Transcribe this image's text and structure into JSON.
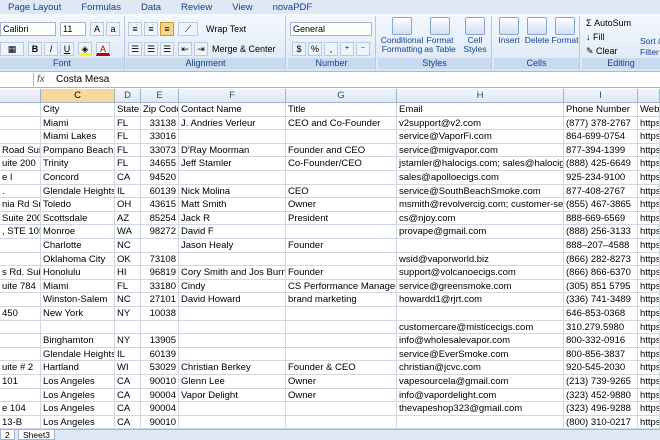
{
  "ribbon_tabs": [
    "Page Layout",
    "Formulas",
    "Data",
    "Review",
    "View",
    "novaPDF"
  ],
  "font": {
    "name": "Calibri",
    "size": "11",
    "group_label": "Font",
    "bold": "B",
    "italic": "I",
    "underline": "U",
    "color_a": "A"
  },
  "alignment": {
    "group_label": "Alignment",
    "wrap_text": "Wrap Text",
    "merge_center": "Merge & Center"
  },
  "number": {
    "group_label": "Number",
    "format": "General",
    "currency": "$",
    "percent": "%",
    "comma": ","
  },
  "styles": {
    "group_label": "Styles",
    "conditional": "Conditional Formatting",
    "format_table": "Format as Table",
    "cell_styles": "Cell Styles"
  },
  "cells": {
    "group_label": "Cells",
    "insert": "Insert",
    "delete": "Delete",
    "format": "Format"
  },
  "editing": {
    "group_label": "Editing",
    "autosum": "AutoSum",
    "fill": "Fill",
    "clear": "Clear",
    "sort": "Sort & Filter"
  },
  "formula_bar": {
    "fx": "fx",
    "value": "Costa Mesa"
  },
  "columns": [
    "C",
    "D",
    "E",
    "F",
    "G",
    "H",
    "I"
  ],
  "header_row": [
    "City",
    "State",
    "Zip Code",
    "Contact Name",
    "Title",
    "Email",
    "Phone Number",
    "Web"
  ],
  "rows": [
    {
      "a": "",
      "c": "Miami",
      "d": "FL",
      "e": "33138",
      "f": "J. Andries Verleur",
      "g": "CEO and Co-Founder",
      "h": "v2support@v2.com",
      "i": "(877) 378-2767",
      "j": "https"
    },
    {
      "a": "",
      "c": "Miami Lakes",
      "d": "FL",
      "e": "33016",
      "f": "",
      "g": "",
      "h": "service@VaporFi.com",
      "i": "864-699-0754",
      "j": "https"
    },
    {
      "a": "Road Suite",
      "c": "Pompano Beach",
      "d": "FL",
      "e": "33073",
      "f": "D'Ray Moorman",
      "g": "Founder and CEO",
      "h": "service@migvapor.com",
      "i": "877-394-1399",
      "j": "https"
    },
    {
      "a": "uite 200",
      "c": "Trinity",
      "d": "FL",
      "e": "34655",
      "f": "Jeff Stamler",
      "g": "Co-Founder/CEO",
      "h": "jstamler@halocigs.com; sales@halocigs.c",
      "i": "(888) 425-6649",
      "j": "https"
    },
    {
      "a": "e I",
      "c": "Concord",
      "d": "CA",
      "e": "94520",
      "f": "",
      "g": "",
      "h": "sales@apolloecigs.com",
      "i": "925-234-9100",
      "j": "https"
    },
    {
      "a": ".",
      "c": "Glendale Heights",
      "d": "IL",
      "e": "60139",
      "f": "Nick Molina",
      "g": "CEO",
      "h": "service@SouthBeachSmoke.com",
      "i": "877-408-2767",
      "j": "https"
    },
    {
      "a": "nia Rd Suit",
      "c": "Toledo",
      "d": "OH",
      "e": "43615",
      "f": "Matt Smith",
      "g": "Owner",
      "h": "msmith@revolvercig.com; customer-serv",
      "i": "(855) 467-3865",
      "j": "https"
    },
    {
      "a": "Suite 200",
      "c": "Scottsdale",
      "d": "AZ",
      "e": "85254",
      "f": "Jack R",
      "g": "President",
      "h": "cs@njoy.com",
      "i": "888-669-6569",
      "j": "https"
    },
    {
      "a": ", STE 105,",
      "c": "Monroe",
      "d": "WA",
      "e": "98272",
      "f": "David F",
      "g": "",
      "h": "provape@gmail.com",
      "i": "(888) 256-3133",
      "j": "https"
    },
    {
      "a": "",
      "c": "Charlotte",
      "d": "NC",
      "e": "",
      "f": "Jason Healy",
      "g": "Founder",
      "h": "",
      "i": "888–207–4588",
      "j": "https"
    },
    {
      "a": "",
      "c": "Oklahoma City",
      "d": "OK",
      "e": "73108",
      "f": "",
      "g": "",
      "h": "wsid@vaporworld.biz",
      "i": "(866) 282-8273",
      "j": "https"
    },
    {
      "a": "s Rd. Suite",
      "c": "Honolulu",
      "d": "HI",
      "e": "96819",
      "f": "Cory Smith and Jos Burnett",
      "g": "Founder",
      "h": "support@volcanoecigs.com",
      "i": "(866) 866-6370",
      "j": "https"
    },
    {
      "a": "uite 784",
      "c": "Miami",
      "d": "FL",
      "e": "33180",
      "f": "Cindy",
      "g": "CS Performance Manager",
      "h": "service@greensmoke.com",
      "i": "(305) 851 5795",
      "j": "https"
    },
    {
      "a": "",
      "c": "Winston-Salem",
      "d": "NC",
      "e": "27101",
      "f": "David Howard",
      "g": " brand marketing",
      "h": "howardd1@rjrt.com",
      "i": "(336) 741-3489",
      "j": "https"
    },
    {
      "a": "450",
      "c": "New York",
      "d": "NY",
      "e": "10038",
      "f": "",
      "g": "",
      "h": "",
      "i": "646-853-0368",
      "j": "https"
    },
    {
      "a": "",
      "c": "",
      "d": "",
      "e": "",
      "f": "",
      "g": "",
      "h": "customercare@misticecigs.com",
      "i": "310.279.5980",
      "j": "https"
    },
    {
      "a": "",
      "c": "Binghamton",
      "d": "NY",
      "e": "13905",
      "f": "",
      "g": "",
      "h": "info@wholesalevapor.com",
      "i": "800-332-0916",
      "j": "https"
    },
    {
      "a": "",
      "c": "Glendale Heights",
      "d": "IL",
      "e": "60139",
      "f": "",
      "g": "",
      "h": "service@EverSmoke.com",
      "i": "800-856-3837",
      "j": "https"
    },
    {
      "a": "uite # 2",
      "c": "Hartland",
      "d": "WI",
      "e": "53029",
      "f": "Christian Berkey",
      "g": "Founder & CEO",
      "h": "christian@jcvc.com",
      "i": "920-545-2030",
      "j": "https"
    },
    {
      "a": "101",
      "c": "Los Angeles",
      "d": "CA",
      "e": "90010",
      "f": "Glenn Lee",
      "g": "Owner",
      "h": "vapesourcela@gmail.com",
      "i": "(213) 739-9265",
      "j": "https"
    },
    {
      "a": "",
      "c": "Los Angeles",
      "d": "CA",
      "e": "90004",
      "f": "Vapor Delight",
      "g": "Owner",
      "h": "info@vapordelight.com",
      "i": "(323) 452-9880",
      "j": "https"
    },
    {
      "a": "e 104",
      "c": "Los Angeles",
      "d": "CA",
      "e": "90004",
      "f": "",
      "g": "",
      "h": "thevapeshop323@gmail.com",
      "i": "(323) 496-9288",
      "j": "https"
    },
    {
      "a": "13-B",
      "c": "Los Angeles",
      "d": "CA",
      "e": "90010",
      "f": "",
      "g": "",
      "h": "",
      "i": "(800) 310-0217",
      "j": "https"
    },
    {
      "a": "e 210",
      "c": "Los Angeles",
      "d": "CA",
      "e": "90027",
      "f": "",
      "g": "",
      "h": "vforvapesales@gmail.com",
      "i": "323-928-2148",
      "j": "https"
    }
  ],
  "sheets": [
    "2",
    "Sheet3"
  ]
}
